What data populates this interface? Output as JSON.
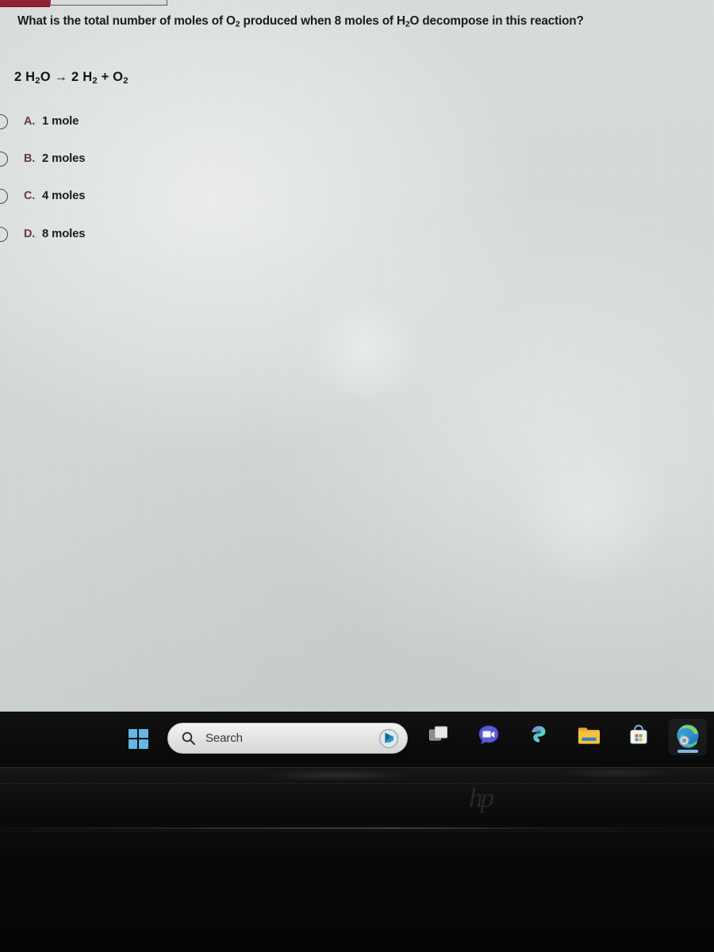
{
  "document": {
    "question": "What is the total number of moles of O2 produced when 8 moles of H2O decompose in this reaction?",
    "question_parts": [
      {
        "text": "What is the total number of moles of O",
        "sub": false
      },
      {
        "text": "2",
        "sub": true
      },
      {
        "text": " produced when 8 moles of H",
        "sub": false
      },
      {
        "text": "2",
        "sub": true
      },
      {
        "text": "O decompose in this reaction?",
        "sub": false
      }
    ],
    "equation": "2 H2O → 2 H2 + O2",
    "equation_parts": [
      {
        "text": "2 H",
        "sub": false
      },
      {
        "text": "2",
        "sub": true
      },
      {
        "text": "O → 2 H",
        "sub": false
      },
      {
        "text": "2",
        "sub": true
      },
      {
        "text": " + O",
        "sub": false
      },
      {
        "text": "2",
        "sub": true
      }
    ],
    "options": [
      {
        "letter": "A.",
        "text": "1 mole",
        "selected": false
      },
      {
        "letter": "B.",
        "text": "2 moles",
        "selected": false
      },
      {
        "letter": "C.",
        "text": "4 moles",
        "selected": false
      },
      {
        "letter": "D.",
        "text": "8 moles",
        "selected": false
      }
    ]
  },
  "taskbar": {
    "start_label": "Start",
    "search": {
      "placeholder": "Search",
      "value": "",
      "icon": "search-icon",
      "trailing_icon": "bing-copilot-icon"
    },
    "items": [
      {
        "name": "task-view",
        "label": "Task View",
        "icon": "task-view-icon",
        "active": false
      },
      {
        "name": "chat-teams",
        "label": "Chat",
        "icon": "teams-chat-icon",
        "active": false
      },
      {
        "name": "copilot",
        "label": "Copilot",
        "icon": "copilot-swirl-icon",
        "active": false
      },
      {
        "name": "file-explorer",
        "label": "File Explorer",
        "icon": "folder-icon",
        "active": false
      },
      {
        "name": "microsoft-store",
        "label": "Microsoft Store",
        "icon": "store-bag-icon",
        "active": false
      },
      {
        "name": "microsoft-edge",
        "label": "Microsoft Edge",
        "icon": "edge-swirl-icon",
        "active": true
      }
    ]
  },
  "hardware": {
    "brand_logo": "hp"
  },
  "colors": {
    "screen_background": "#d6dbda",
    "text": "#1b1b1b",
    "option_letter": "#6b3b3d",
    "taskbar_background": "#0c0c0c",
    "accent_blue": "#63b8e8",
    "top_bar_red": "#8e2430",
    "active_indicator": "#79b8e8"
  }
}
